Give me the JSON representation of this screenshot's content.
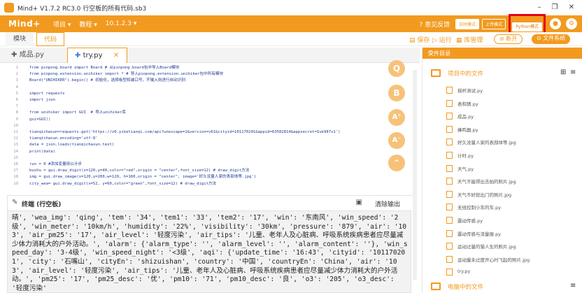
{
  "window": {
    "title": "Mind+ V1.7.2 RC3.0   行空板的所有代码.sb3",
    "minimize": "–",
    "maximize": "❐",
    "close": "✕"
  },
  "menubar": {
    "brand": "Mind+",
    "items": [
      "项目 ▾",
      "教程 ▾",
      "10.1.2.3 ▾"
    ],
    "feedback": "意见反馈",
    "modes": [
      "实时模式",
      "上传模式",
      "Python模式"
    ]
  },
  "toolbar": {
    "tabs": [
      "模块",
      "代码"
    ],
    "save": "保存",
    "run": "运行",
    "library": "库管理",
    "disconnected": "⊘ 断开",
    "file_system": "⊙ 文件系统"
  },
  "file_tabs": [
    {
      "label": "成品.py",
      "active": false
    },
    {
      "label": "try.py",
      "active": true,
      "close": "✕"
    }
  ],
  "code_lines": [
    {
      "n": "1",
      "text": "from pinpong.board import Board # 从pinpong.board包中导入Board模块"
    },
    {
      "n": "2",
      "text": "from pinpong.extension.unihiker import * # 导入pinpong.extension.unihiker包中所有模块"
    },
    {
      "n": "3",
      "text": "Board(\"UNIHIKER\").begin() # 初始化，选择板型和端口号，不输入则进行自动识别"
    },
    {
      "n": "4",
      "text": ""
    },
    {
      "n": "5",
      "text": "import requests"
    },
    {
      "n": "6",
      "text": "import json"
    },
    {
      "n": "7",
      "text": ""
    },
    {
      "n": "8",
      "text": "from unihiker import GUI  # 导入unihiker库"
    },
    {
      "n": "9",
      "text": "gui=GUI()"
    },
    {
      "n": "10",
      "text": ""
    },
    {
      "n": "11",
      "text": "tianqichaxun=requests.get('https://v0.yiketianqi.com/api?unescape=1&version=v61&cityid=101170201&appid=63582814&appsecret=Iuk987v1')"
    },
    {
      "n": "12",
      "text": "tianqichaxun.encoding='utf-8'"
    },
    {
      "n": "13",
      "text": "data = json.loads(tianqichaxun.text)"
    },
    {
      "n": "14",
      "text": "print(data)"
    },
    {
      "n": "15",
      "text": ""
    },
    {
      "n": "16",
      "text": "run = 0 #添加变量用以计步"
    },
    {
      "n": "17",
      "text": "bushu = gui.draw_digit(x=120,y=40,color=\"red\",origin = \"center\",font_size=12) # draw_digit方法"
    },
    {
      "n": "18",
      "text": "img = gui.draw_image(x=120,y=200,w=120, h=160,origin = \"center\", image='好久没量人家的表部体等.jpg')"
    },
    {
      "n": "19",
      "text": "city_wea= gui.draw_digit(x=52, y=60,color=\"green\",font_size=12) # draw_digit方法"
    }
  ],
  "float_buttons": [
    "Q",
    "B",
    "A⁺",
    "A⁻",
    "⌃"
  ],
  "terminal": {
    "title": "终端 (行空板)",
    "clear": "清除输出",
    "output": "晴', 'wea_img': 'qing', 'tem': '34', 'tem1': '33', 'tem2': '17', 'win': '东南风', 'win_speed': '2级', 'win_meter': '10km/h', 'humidity': '22%', 'visibility': '30km', 'pressure': '879', 'air': '103', 'air_pm25': '17', 'air_level': '轻度污染', 'air_tips': '儿童、老年人及心脏病、呼吸系统疾病患者应尽量减少体力消耗大的户外活动。', 'alarm': {'alarm_type': '', 'alarm_level': '', 'alarm_content': ''}, 'win_speed_day': '3-4级', 'win_speed_night': '<3级', 'aqi': {'update_time': '16:43', 'cityid': '101170201', 'city': '石嘴山', 'cityEn': 'shizuishan', 'country': '中国', 'countryEn': 'China', 'air': '103', 'air_level': '轻度污染', 'air_tips': '儿童、老年人及心脏病、呼吸系统疾病患者应尽量减少体力消耗大的户外活动。', 'pm25': '17', 'pm25_desc': '优', 'pm10': '71', 'pm10_desc': '良', 'o3': '205', 'o3_desc': '轻度污染'"
  },
  "panel": {
    "header": "文件目录",
    "project_section": "项目中的文件",
    "computer_section": "电脑中的文件",
    "files": [
      "摇杆测试.py",
      "表和猜.py",
      "成品.py",
      "蜂鸣器.py",
      "好久没量人家的表部体等.jpg",
      "计时.py",
      "天气.py",
      "天气不能得出去拍的照片.jpg",
      "天气不好就出门的照片.jpg",
      "无线控制小车的车.py",
      "震动传感.py",
      "震动传感与流量振.py",
      "运动过量的猫人生的照片.jpg",
      "运动量未过度开心时飞起的照片.jpg",
      "try.py"
    ]
  },
  "colors": {
    "accent": "#f29a1f",
    "highlight": "#e60012"
  }
}
